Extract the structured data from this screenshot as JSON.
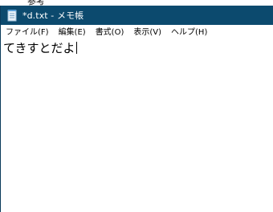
{
  "background_window": {
    "partial_text": "参考"
  },
  "window": {
    "title": "*d.txt - メモ帳",
    "titlebar_color": "#0c4a6e",
    "app_icon": "notepad-icon"
  },
  "menu": {
    "items": [
      {
        "label": "ファイル(F)"
      },
      {
        "label": "編集(E)"
      },
      {
        "label": "書式(O)"
      },
      {
        "label": "表示(V)"
      },
      {
        "label": "ヘルプ(H)"
      }
    ]
  },
  "editor": {
    "content": "てきすとだよ"
  }
}
